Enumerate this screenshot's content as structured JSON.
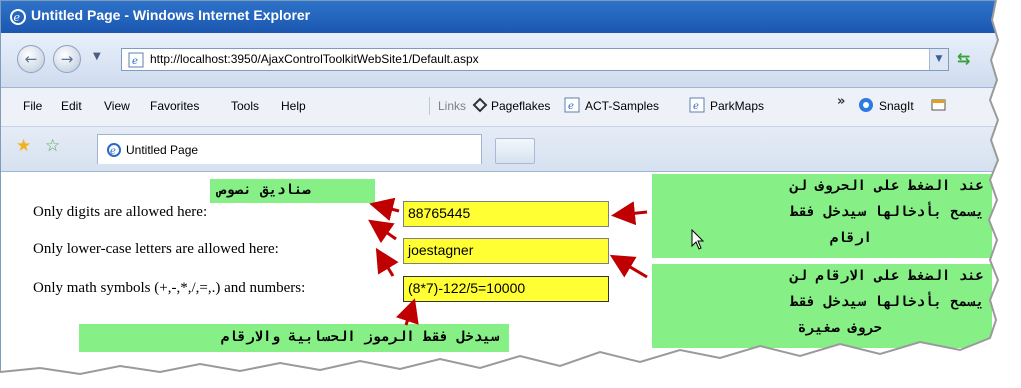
{
  "window": {
    "title": "Untitled Page - Windows Internet Explorer"
  },
  "address_bar": {
    "url": "http://localhost:3950/AjaxControlToolkitWebSite1/Default.aspx"
  },
  "menu": {
    "items": [
      "File",
      "Edit",
      "View",
      "Favorites",
      "Tools",
      "Help"
    ]
  },
  "links_bar": {
    "label": "Links",
    "items": [
      "Pageflakes",
      "ACT-Samples",
      "ParkMaps"
    ],
    "snagit": "SnagIt"
  },
  "tabs": {
    "active_label": "Untitled Page"
  },
  "form": {
    "fields": [
      {
        "label": "Only digits are allowed here:",
        "value": "88765445"
      },
      {
        "label": "Only lower-case letters are allowed here:",
        "value": "joestagner"
      },
      {
        "label": "Only math symbols (+,-,*,/,=,.) and numbers:",
        "value": "(8*7)-122/5=10000"
      }
    ]
  },
  "annotations": {
    "textboxes": "صناديق نصوص",
    "right_top": [
      "عند الضغط على الحروف لن",
      "يسمح بأدخالها سيدخل فقط",
      "ارقام"
    ],
    "right_bottom": [
      "عند الضغط على الارقام لن",
      "يسمح بأدخالها سيدخل فقط",
      "حروف صغيرة"
    ],
    "bottom": "سيدخل فقط الرموز الحسابية والارقام"
  },
  "colors": {
    "highlight": "#86f086",
    "textbox_bg": "#ffff33",
    "arrow": "#c00000",
    "titlebar": "#2466c0"
  }
}
